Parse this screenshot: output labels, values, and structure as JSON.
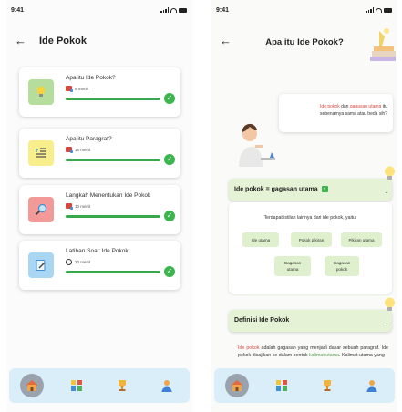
{
  "left": {
    "status_time": "9:41",
    "title": "Ide Pokok",
    "lessons": [
      {
        "title": "Apa itu Ide Pokok?",
        "duration": "5 menit",
        "meta_icon": "book-icon",
        "icon": "lightbulb-icon",
        "thumb_color": "#b5dd9c",
        "progress": 1.0
      },
      {
        "title": "Apa itu Paragraf?",
        "duration": "15 menit",
        "meta_icon": "book-icon",
        "icon": "paragraph-icon",
        "thumb_color": "#f8ee8c",
        "progress": 1.0
      },
      {
        "title": "Langkah Menentukan Ide Pokok",
        "duration": "10 menit",
        "meta_icon": "book-icon",
        "icon": "magnifier-icon",
        "thumb_color": "#f39a98",
        "progress": 1.0
      },
      {
        "title": "Latihan Soal: Ide Pokok",
        "duration": "30 menit",
        "meta_icon": "clock-icon",
        "icon": "edit-icon",
        "thumb_color": "#a9d7f3",
        "progress": 1.0
      }
    ]
  },
  "right": {
    "status_time": "9:41",
    "title": "Apa itu Ide Pokok?",
    "speech": {
      "hl1": "Ide pokok",
      "mid": " dan ",
      "hl2": "gagasan utama",
      "rest": " itu",
      "line2": "sebenarnya sama atau beda sih?"
    },
    "section1": {
      "title": "Ide pokok = gagasan utama",
      "intro": "Terdapat istilah lainnya dari ide pokok, yaitu:",
      "chips": [
        "Ide utama",
        "Pokok pikiran",
        "Pikiran utama",
        "Gagasan utama",
        "Gagasan pokok"
      ]
    },
    "section2": {
      "title": "Definisi Ide Pokok",
      "hl1": "Ide pokok",
      "text1": " adalah gagasan yang menjadi dasar sebuah paragraf. Ide pokok disajikan ke dalam bentuk ",
      "hl2": "kalimat utama",
      "text2": ". Kalimat utama yang"
    }
  },
  "nav": [
    "home-icon",
    "lessons-icon",
    "trophy-icon",
    "profile-icon"
  ],
  "colors": {
    "progress": "#38a84c",
    "check": "#3bb54e",
    "nav_bg": "#d9eef8",
    "section_head": "#e6f2d5",
    "chip": "#dff0cf",
    "highlight": "#e0473f",
    "highlight_green": "#4da34d"
  }
}
